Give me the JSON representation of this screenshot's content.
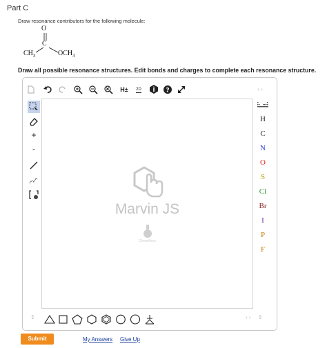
{
  "part_title": "Part C",
  "prompt": "Draw resonance contributors for the following molecule:",
  "molecule": {
    "oxygen": "O",
    "carbon": "C",
    "left_group": "CH",
    "left_sub": "3",
    "right_group": "OCH",
    "right_sub": "3"
  },
  "instruction": "Draw all possible resonance structures. Edit bonds and charges to complete each resonance structure.",
  "editor": {
    "top_toolbar": {
      "charge_label": "H±",
      "twoD_label": "2D"
    },
    "left_tools": {
      "plus": "+",
      "minus": "-"
    },
    "elements": [
      "H",
      "C",
      "N",
      "O",
      "S",
      "Cl",
      "Br",
      "I",
      "P",
      "F"
    ],
    "element_colors": [
      "#222222",
      "#222222",
      "#2a3fd0",
      "#e0201a",
      "#b59a00",
      "#2e9b2e",
      "#8b2a2a",
      "#7a2da0",
      "#c47a00",
      "#c47a00"
    ],
    "watermark": "Marvin JS",
    "watermark_sub": "ChemAxon"
  },
  "footer": {
    "submit_label": "Submit",
    "my_answers": "My Answers",
    "give_up": "Give Up"
  },
  "colors": {
    "submit": "#f08c1e",
    "link": "#1a3e9c"
  }
}
